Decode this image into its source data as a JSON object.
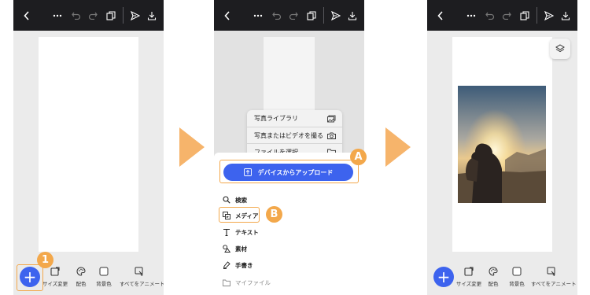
{
  "panel1": {
    "tools": [
      {
        "label": "サイズ変更",
        "icon": "resize-icon"
      },
      {
        "label": "配色",
        "icon": "palette-icon"
      },
      {
        "label": "背景色",
        "icon": "background-color-icon"
      },
      {
        "label": "すべてをアニメート",
        "icon": "animate-all-icon"
      }
    ],
    "badge": "1"
  },
  "panel2": {
    "popover": [
      {
        "label": "写真ライブラリ",
        "icon": "photo-library-icon"
      },
      {
        "label": "写真またはビデオを撮る",
        "icon": "camera-icon"
      },
      {
        "label": "ファイルを選択",
        "icon": "folder-icon"
      }
    ],
    "upload_label": "デバイスからアップロード",
    "menu": [
      {
        "label": "検索",
        "icon": "search-icon"
      },
      {
        "label": "メディア",
        "icon": "media-icon"
      },
      {
        "label": "テキスト",
        "icon": "text-icon"
      },
      {
        "label": "素材",
        "icon": "elements-icon"
      },
      {
        "label": "手書き",
        "icon": "draw-icon"
      },
      {
        "label": "マイファイル",
        "icon": "folder-icon"
      }
    ],
    "badge_a": "A",
    "badge_b": "B"
  },
  "panel3": {
    "tools": [
      {
        "label": "サイズ変更",
        "icon": "resize-icon"
      },
      {
        "label": "配色",
        "icon": "palette-icon"
      },
      {
        "label": "背景色",
        "icon": "background-color-icon"
      },
      {
        "label": "すべてをアニメート",
        "icon": "animate-all-icon"
      }
    ]
  },
  "colors": {
    "topbar": "#1d1d20",
    "accent": "#3d63ee",
    "callout": "#f3a84b",
    "arrow": "#f6b46b",
    "workspace": "#ebebeb"
  }
}
